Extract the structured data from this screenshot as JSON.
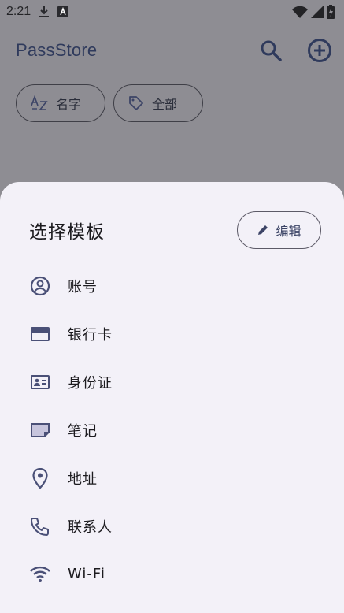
{
  "status_bar": {
    "time": "2:21",
    "left_icons": [
      "download-icon",
      "text-a-icon"
    ],
    "right_icons": [
      "wifi-icon",
      "cellular-signal-icon",
      "battery-icon"
    ]
  },
  "app_bar": {
    "title": "PassStore",
    "actions": [
      "search-icon",
      "add-circle-icon"
    ]
  },
  "chips": {
    "sort_label": "名字",
    "filter_label": "全部"
  },
  "sheet": {
    "title": "选择模板",
    "edit_label": "编辑",
    "items": [
      {
        "label": "账号",
        "icon": "account-circle-icon"
      },
      {
        "label": "银行卡",
        "icon": "credit-card-icon"
      },
      {
        "label": "身份证",
        "icon": "id-card-icon"
      },
      {
        "label": "笔记",
        "icon": "note-icon"
      },
      {
        "label": "地址",
        "icon": "location-pin-icon"
      },
      {
        "label": "联系人",
        "icon": "phone-icon"
      },
      {
        "label": "Wi-Fi",
        "icon": "wifi-icon"
      }
    ]
  },
  "colors": {
    "scrim_background": "#8e8d93",
    "sheet_background": "#f3f1f8",
    "icon_tint": "#4a5077",
    "title_color": "#2f3a5c"
  }
}
